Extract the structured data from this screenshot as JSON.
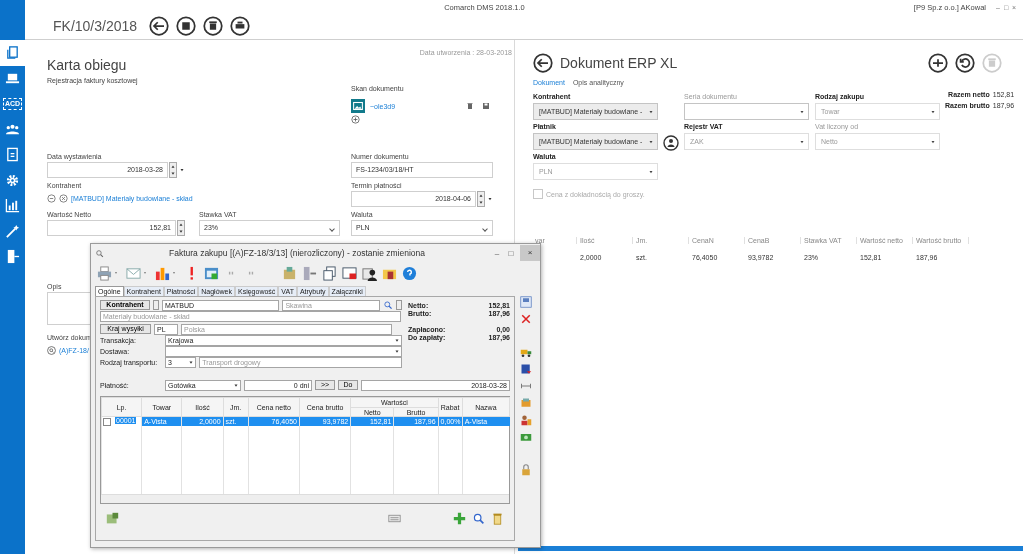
{
  "app": {
    "title": "Comarch DMS 2018.1.0",
    "user": "[P9 Sp.z o.o.] AKowal",
    "window_controls": [
      "–",
      "□",
      "×"
    ]
  },
  "sidebar": {
    "items": [
      {
        "selected": true
      },
      {
        "selected": false
      },
      {
        "label": "ACD",
        "selected": false
      },
      {
        "selected": false
      },
      {
        "selected": false
      },
      {
        "selected": false
      },
      {
        "selected": false
      },
      {
        "selected": false
      },
      {
        "selected": false
      }
    ]
  },
  "header": {
    "document_number": "FK/10/3/2018"
  },
  "card": {
    "created": "Data utworzenia : 28-03-2018",
    "title": "Karta obiegu",
    "subtitle": "Rejestracja faktury kosztowej",
    "scan": {
      "label": "Skan dokumentu",
      "file": "~ole3d9"
    },
    "issue_date": {
      "label": "Data wystawienia",
      "value": "2018-03-28"
    },
    "document_no": {
      "label": "Numer dokumentu",
      "value": "FS-1234/03/18/HT"
    },
    "contractor": {
      "label": "Kontrahent",
      "value": "[MATBUD] Materiały budowlane - skład"
    },
    "due_date": {
      "label": "Termin płatności",
      "value": "2018-04-06"
    },
    "net_value": {
      "label": "Wartość Netto",
      "value": "152,81"
    },
    "vat_rate": {
      "label": "Stawka VAT",
      "value": "23%"
    },
    "currency": {
      "label": "Waluta",
      "value": "PLN"
    },
    "description": {
      "label": "Opis"
    },
    "create_document": {
      "label": "Utwórz dokum",
      "link": "(A)FZ-18/"
    }
  },
  "erp": {
    "title": "Dokument ERP XL",
    "tabs": [
      {
        "label": "Dokument",
        "selected": true
      },
      {
        "label": "Opis analityczny",
        "selected": false
      }
    ],
    "fields": [
      {
        "label": "Kontrahent",
        "value": "[MATBUD] Materiały budowlane -",
        "required": true,
        "disabled": false,
        "kind": "lookup"
      },
      {
        "label": "Seria dokumentu",
        "required": false,
        "disabled": false,
        "kind": "select"
      },
      {
        "label": "Rodzaj zakupu",
        "value": "Towar",
        "required": true,
        "disabled": true,
        "kind": "select"
      },
      {
        "label": "Płatnik",
        "value": "[MATBUD] Materiały budowlane -",
        "required": true,
        "disabled": false,
        "kind": "lookup"
      },
      {
        "label": "Rejestr VAT",
        "value": "ZAK",
        "required": true,
        "disabled": true,
        "kind": "select"
      },
      {
        "label": "Vat liczony od",
        "value": "Netto",
        "required": false,
        "disabled": true,
        "kind": "select"
      },
      {
        "label": "Waluta",
        "value": "PLN",
        "required": true,
        "disabled": true,
        "kind": "select"
      }
    ],
    "totals": [
      {
        "label": "Razem netto",
        "value": "152,81"
      },
      {
        "label": "Razem brutto",
        "value": "187,96"
      }
    ],
    "price_precision": {
      "label": "Cena z dokładnością do groszy.",
      "checked": false,
      "disabled": true
    },
    "items_table": {
      "columns": [
        "var",
        "Ilość",
        "Jm.",
        "CenaN",
        "CenaB",
        "Stawka VAT",
        "Wartość netto",
        "Wartość brutto"
      ],
      "rows": [
        [
          "",
          "2,0000",
          "szt.",
          "76,4050",
          "93,9782",
          "23%",
          "152,81",
          "187,96"
        ]
      ]
    }
  },
  "dialog": {
    "title": "Faktura zakupu [(A)FZ-18/3/13] (nierozliczony) - zostanie zmieniona",
    "window_controls": [
      "–",
      "□",
      "×"
    ],
    "tabs": [
      {
        "label": "Ogólne",
        "selected": true
      },
      {
        "label": "Kontrahent",
        "selected": false
      },
      {
        "label": "Płatności",
        "selected": false
      },
      {
        "label": "Nagłówek",
        "selected": false
      },
      {
        "label": "Księgowość",
        "selected": false
      },
      {
        "label": "VAT",
        "selected": false
      },
      {
        "label": "Atrybuty",
        "selected": false
      },
      {
        "label": "Załączniki",
        "selected": false
      }
    ],
    "contractor": {
      "button": "Kontrahent",
      "code": "MATBUD",
      "city": "Skawina",
      "name": "Materiały budowlane - skład"
    },
    "shipping_country": {
      "button": "Kraj wysyłki",
      "code": "PL",
      "name": "Polska"
    },
    "transaction": {
      "label": "Transakcja:",
      "value": "Krajowa"
    },
    "delivery": {
      "label": "Dostawa:"
    },
    "transport": {
      "label": "Rodzaj transportu:",
      "code": "3",
      "name": "Transport drogowy"
    },
    "totals": [
      {
        "label": "Netto:",
        "value": "152,81"
      },
      {
        "label": "Brutto:",
        "value": "187,96"
      }
    ],
    "payments": [
      {
        "label": "Zapłacono:",
        "value": "0,00"
      },
      {
        "label": "Do zapłaty:",
        "value": "187,96"
      }
    ],
    "payment": {
      "label": "Płatność:",
      "method": "Gotówka",
      "days": "0 dni",
      "shift_button": ">>",
      "to_button": "Do",
      "date": "2018-03-28"
    },
    "grid": {
      "columns": [
        {
          "label": "Lp."
        },
        {
          "label": "Towar"
        },
        {
          "label": "Ilość"
        },
        {
          "label": "Jm."
        },
        {
          "label": "Cena netto"
        },
        {
          "label": "Cena brutto"
        },
        {
          "label": "Wartości",
          "colspan": 2,
          "sub": [
            "Netto",
            "Brutto"
          ]
        },
        {
          "label": "Rabat"
        },
        {
          "label": "Nazwa"
        }
      ],
      "rows": [
        {
          "selected": true,
          "checked": false,
          "cells": [
            "00001",
            "A-Vista",
            "2,0000",
            "szt.",
            "76,4050",
            "93,9782",
            "152,81",
            "187,96",
            "0,00%",
            "A-Vista"
          ]
        }
      ]
    }
  }
}
